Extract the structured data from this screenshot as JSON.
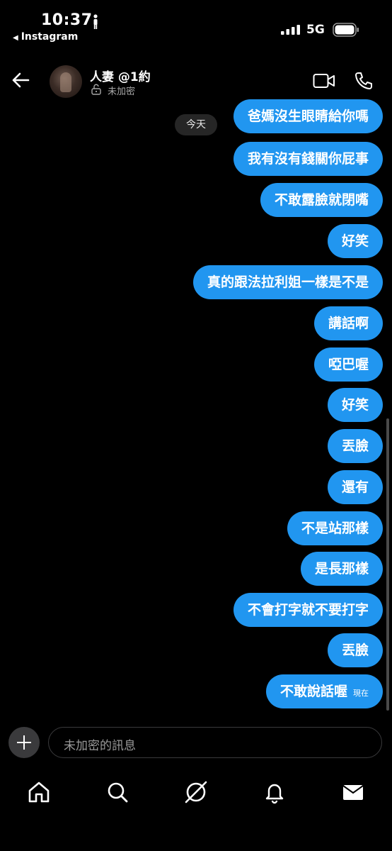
{
  "status_bar": {
    "time": "10:37",
    "back_app": "Instagram",
    "network": "5G"
  },
  "header": {
    "name": "人妻 @1約",
    "encryption": "未加密"
  },
  "thread": {
    "date_separator": "今天",
    "messages": [
      "爸媽沒生眼睛給你嗎",
      "我有沒有錢關你屁事",
      "不敢露臉就閉嘴",
      "好笑",
      "真的跟法拉利姐一樣是不是",
      "講話啊",
      "啞巴喔",
      "好笑",
      "丟臉",
      "還有",
      "不是站那樣",
      "是長那樣",
      "不會打字就不要打字",
      "丟臉",
      "不敢說話喔"
    ],
    "last_timestamp": "現在"
  },
  "composer": {
    "placeholder": "未加密的訊息"
  },
  "nav": {
    "icons": [
      "home-icon",
      "search-icon",
      "explore-icon",
      "notifications-icon",
      "inbox-icon"
    ]
  },
  "colors": {
    "bubble": "#2196f0",
    "background": "#000000"
  }
}
